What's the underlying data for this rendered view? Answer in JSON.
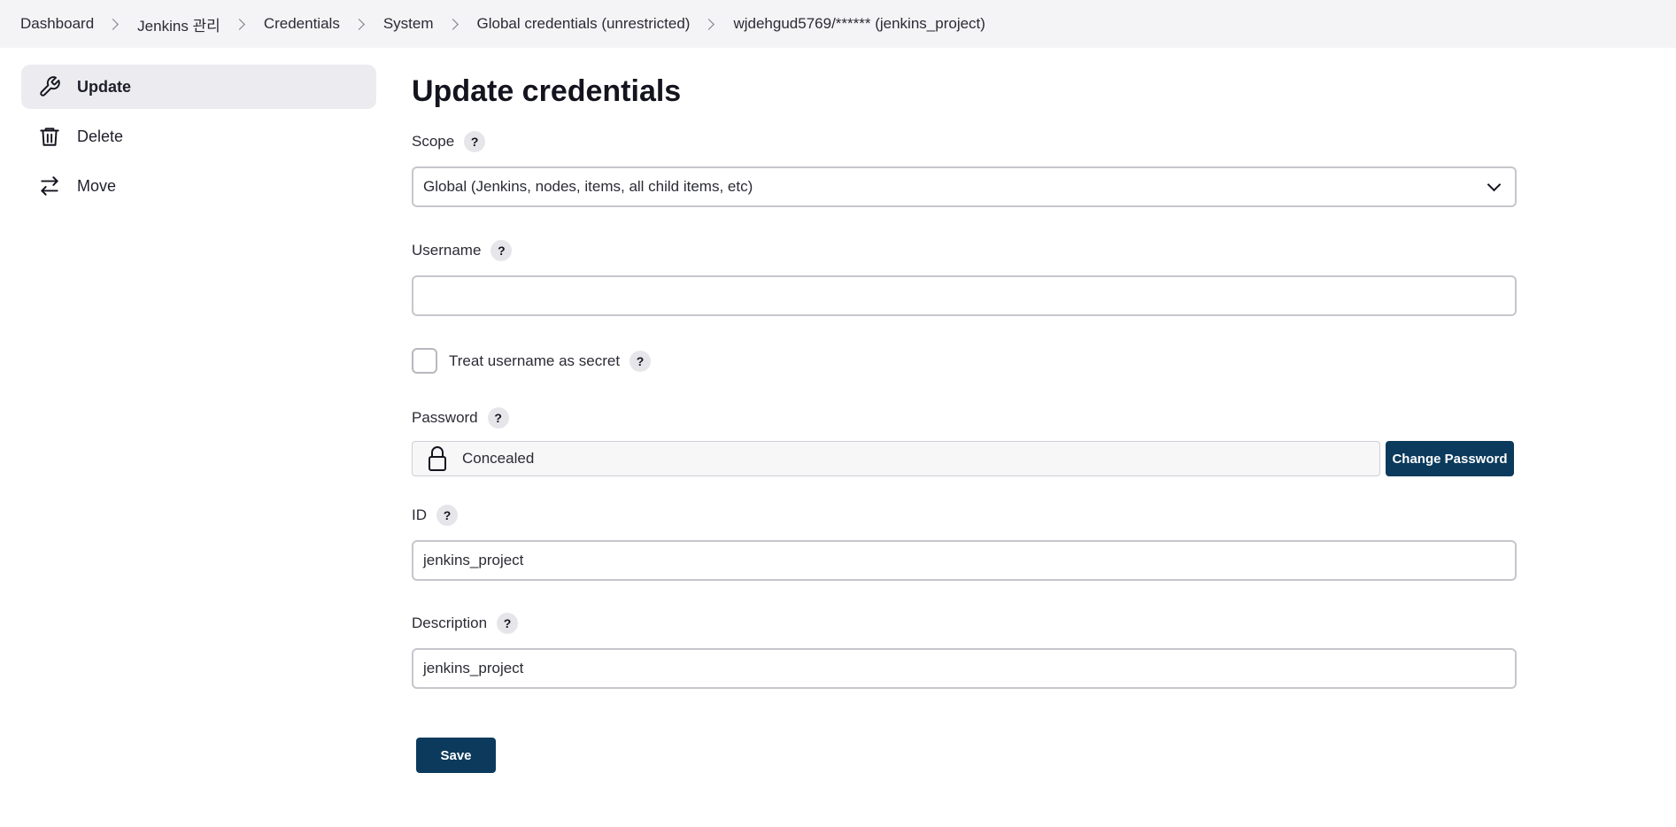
{
  "breadcrumb": {
    "items": [
      {
        "label": "Dashboard"
      },
      {
        "label": "Jenkins 관리"
      },
      {
        "label": "Credentials"
      },
      {
        "label": "System"
      },
      {
        "label": "Global credentials (unrestricted)"
      },
      {
        "label": "wjdehgud5769/****** (jenkins_project)"
      }
    ]
  },
  "sidebar": {
    "items": [
      {
        "label": "Update",
        "icon": "wrench-icon",
        "active": true
      },
      {
        "label": "Delete",
        "icon": "trash-icon",
        "active": false
      },
      {
        "label": "Move",
        "icon": "arrows-swap-icon",
        "active": false
      }
    ]
  },
  "main": {
    "title": "Update credentials",
    "scope": {
      "label": "Scope",
      "value": "Global (Jenkins, nodes, items, all child items, etc)"
    },
    "username": {
      "label": "Username",
      "value": ""
    },
    "treat_secret": {
      "label": "Treat username as secret",
      "checked": false
    },
    "password": {
      "label": "Password",
      "value": "Concealed",
      "change_label": "Change Password"
    },
    "id": {
      "label": "ID",
      "value": "jenkins_project"
    },
    "description": {
      "label": "Description",
      "value": "jenkins_project"
    },
    "help_glyph": "?",
    "save_label": "Save"
  },
  "colors": {
    "primary_button": "#0b3a5c",
    "topbar_bg": "#f4f4f6",
    "active_sidebar_bg": "#ececf0"
  }
}
